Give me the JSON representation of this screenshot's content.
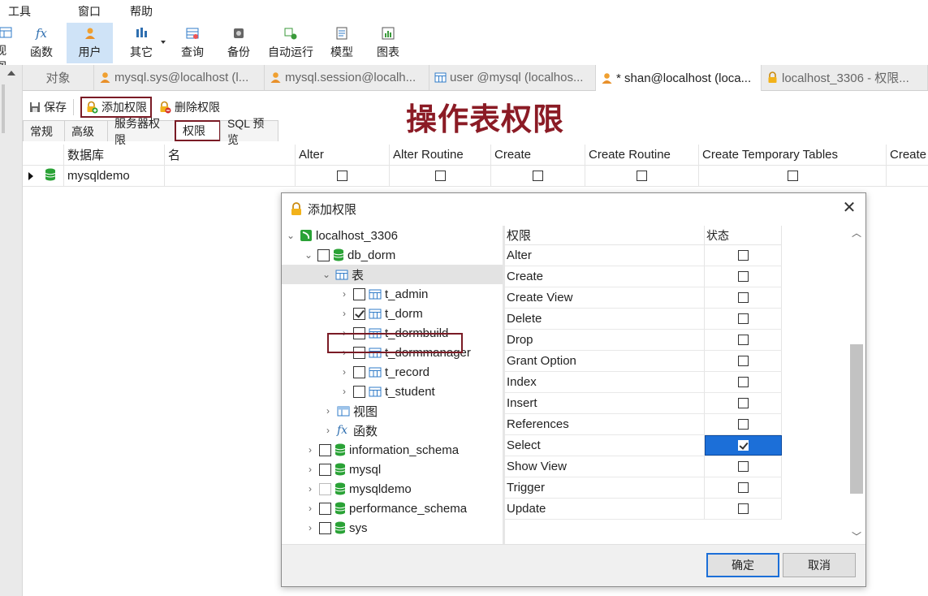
{
  "menubar": [
    "工具",
    "窗口",
    "帮助"
  ],
  "toolbar": [
    {
      "label": "视图",
      "icon": "view-icon"
    },
    {
      "label": "函数",
      "icon": "function-icon"
    },
    {
      "label": "用户",
      "icon": "user-icon",
      "active": true
    },
    {
      "label": "其它",
      "icon": "other-icon"
    },
    {
      "label": "查询",
      "icon": "query-icon"
    },
    {
      "label": "备份",
      "icon": "backup-icon"
    },
    {
      "label": "自动运行",
      "icon": "automation-icon"
    },
    {
      "label": "模型",
      "icon": "model-icon"
    },
    {
      "label": "图表",
      "icon": "chart-icon"
    }
  ],
  "tabs": {
    "objects": "对象",
    "items": [
      {
        "label": "mysql.sys@localhost (l...",
        "icon": "user-icon"
      },
      {
        "label": "mysql.session@localh...",
        "icon": "user-icon"
      },
      {
        "label": "user @mysql (localhos...",
        "icon": "table-icon"
      },
      {
        "label": "* shan@localhost (loca...",
        "icon": "user-icon",
        "active": true
      },
      {
        "label": "localhost_3306 - 权限...",
        "icon": "lock-icon"
      }
    ]
  },
  "subbar": {
    "save": "保存",
    "add_privilege": "添加权限",
    "delete_privilege": "删除权限"
  },
  "annotation": "操作表权限",
  "property_tabs": [
    "常规",
    "高级",
    "服务器权限",
    "权限",
    "SQL 预览"
  ],
  "grid": {
    "columns": [
      "数据库",
      "名",
      "Alter",
      "Alter Routine",
      "Create",
      "Create Routine",
      "Create Temporary Tables",
      "Create"
    ],
    "rows": [
      {
        "database": "mysqldemo",
        "name": ""
      }
    ]
  },
  "dialog": {
    "title": "添加权限",
    "tree": [
      {
        "label": "localhost_3306",
        "level": 0,
        "expanded": true,
        "icon": "connection-icon"
      },
      {
        "label": "db_dorm",
        "level": 1,
        "expanded": true,
        "icon": "database-icon",
        "checkbox": "unchecked"
      },
      {
        "label": "表",
        "level": 2,
        "expanded": true,
        "icon": "tables-icon",
        "selected": true
      },
      {
        "label": "t_admin",
        "level": 3,
        "icon": "table-icon",
        "checkbox": "unchecked"
      },
      {
        "label": "t_dorm",
        "level": 3,
        "icon": "table-icon",
        "checkbox": "checked"
      },
      {
        "label": "t_dormbuild",
        "level": 3,
        "icon": "table-icon",
        "checkbox": "unchecked"
      },
      {
        "label": "t_dormmanager",
        "level": 3,
        "icon": "table-icon",
        "checkbox": "unchecked"
      },
      {
        "label": "t_record",
        "level": 3,
        "icon": "table-icon",
        "checkbox": "unchecked"
      },
      {
        "label": "t_student",
        "level": 3,
        "icon": "table-icon",
        "checkbox": "unchecked"
      },
      {
        "label": "视图",
        "level": 2,
        "icon": "view-icon"
      },
      {
        "label": "函数",
        "level": 2,
        "icon": "function-icon"
      },
      {
        "label": "information_schema",
        "level": 1,
        "icon": "database-icon",
        "checkbox": "unchecked"
      },
      {
        "label": "mysql",
        "level": 1,
        "icon": "database-icon",
        "checkbox": "unchecked"
      },
      {
        "label": "mysqldemo",
        "level": 1,
        "icon": "database-icon",
        "checkbox": "disabled"
      },
      {
        "label": "performance_schema",
        "level": 1,
        "icon": "database-icon",
        "checkbox": "unchecked"
      },
      {
        "label": "sys",
        "level": 1,
        "icon": "database-icon",
        "checkbox": "unchecked"
      }
    ],
    "perm_header": {
      "privilege": "权限",
      "status": "状态"
    },
    "privileges": [
      {
        "name": "Alter",
        "checked": false
      },
      {
        "name": "Create",
        "checked": false
      },
      {
        "name": "Create View",
        "checked": false
      },
      {
        "name": "Delete",
        "checked": false
      },
      {
        "name": "Drop",
        "checked": false
      },
      {
        "name": "Grant Option",
        "checked": false
      },
      {
        "name": "Index",
        "checked": false
      },
      {
        "name": "Insert",
        "checked": false
      },
      {
        "name": "References",
        "checked": false
      },
      {
        "name": "Select",
        "checked": true,
        "selected": true
      },
      {
        "name": "Show View",
        "checked": false
      },
      {
        "name": "Trigger",
        "checked": false
      },
      {
        "name": "Update",
        "checked": false
      }
    ],
    "ok": "确定",
    "cancel": "取消"
  },
  "colors": {
    "accent": "#1c6fd8",
    "highlight_border": "#7a1b25",
    "annotation": "#8b1b25",
    "db_green": "#2aa236"
  }
}
